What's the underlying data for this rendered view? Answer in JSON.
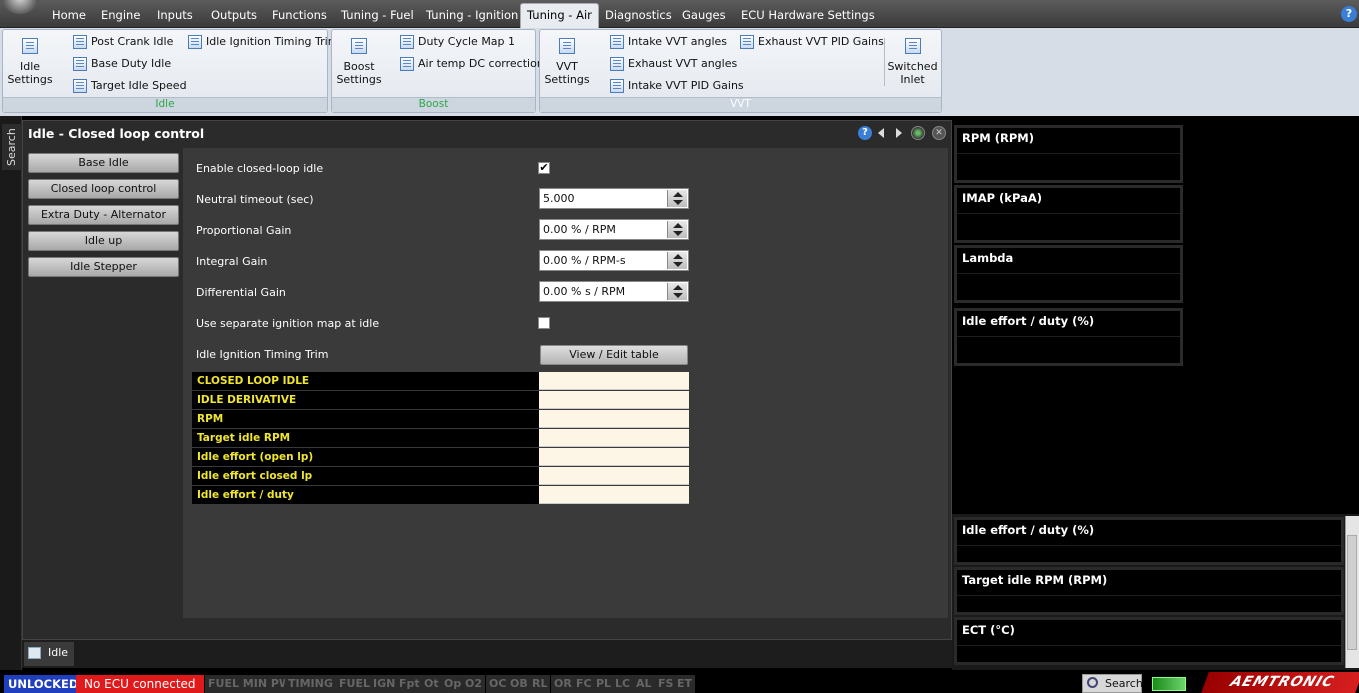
{
  "menu": {
    "items": [
      "Home",
      "Engine",
      "Inputs",
      "Outputs",
      "Functions",
      "Tuning - Fuel",
      "Tuning - Ignition",
      "Tuning - Air",
      "Diagnostics",
      "Gauges",
      "ECU Hardware Settings"
    ],
    "active": "Tuning - Air",
    "help": "?"
  },
  "ribbon": {
    "idle": {
      "group_label": "Idle",
      "big_button": "Idle\nSettings",
      "buttons": [
        "Post Crank Idle",
        "Base Duty Idle",
        "Target Idle Speed",
        "Idle Ignition Timing Trim"
      ]
    },
    "boost": {
      "group_label": "Boost",
      "big_button": "Boost\nSettings",
      "buttons": [
        "Duty Cycle Map 1",
        "Air temp DC correction"
      ]
    },
    "vvt": {
      "group_label": "VVT",
      "big_button": "VVT\nSettings",
      "buttons": [
        "Intake VVT angles",
        "Exhaust VVT angles",
        "Intake VVT PID Gains",
        "Exhaust VVT PID Gains"
      ],
      "big_button_2": "Switched\nInlet"
    }
  },
  "sidebar": {
    "search_tab": "Search"
  },
  "panel": {
    "title": "Idle - Closed loop control",
    "nav": [
      "Base Idle",
      "Closed loop control",
      "Extra Duty - Alternator",
      "Idle up",
      "Idle Stepper"
    ],
    "fields": {
      "enable_label": "Enable closed-loop idle",
      "enable_checked": true,
      "neutral_label": "Neutral timeout (sec)",
      "neutral_value": "5.000",
      "prop_label": "Proportional Gain",
      "prop_value": "0.00 % / RPM",
      "int_label": "Integral Gain",
      "int_value": "0.00 % / RPM-s",
      "diff_label": "Differential Gain",
      "diff_value": "0.00 % s / RPM",
      "sep_label": "Use separate ignition map at idle",
      "sep_checked": false,
      "trim_label": "Idle Ignition Timing Trim",
      "view_button": "View / Edit table"
    },
    "table_rows": [
      "CLOSED LOOP IDLE",
      "IDLE DERIVATIVE",
      "RPM",
      "Target idle RPM",
      "Idle effort (open lp)",
      "Idle effort closed lp",
      "Idle effort / duty"
    ]
  },
  "bottom_tab": {
    "label": "Idle"
  },
  "gauges_top": [
    "RPM (RPM)",
    "IMAP  (kPaA)",
    "Lambda",
    "Idle effort / duty (%)"
  ],
  "gauges_bottom": [
    "Idle effort / duty (%)",
    "Target idle RPM (RPM)",
    "ECT (°C)"
  ],
  "status": {
    "unlocked": "UNLOCKED",
    "no_ecu": "No ECU connected",
    "indicators": [
      "FUEL MIN PW",
      "TIMING",
      "FUEL",
      "IGN",
      "Fpt",
      "Ot",
      "Op",
      "O2",
      "OC",
      "OB",
      "RL",
      "OR",
      "FC",
      "PL",
      "LC",
      "AL",
      "FS",
      "ET"
    ],
    "search": "Search",
    "brand": "AEMTRONIC"
  },
  "colors": {
    "accent_green": "#2aa84a",
    "no_ecu": "#e01a1a",
    "unlocked": "#1f3fbf",
    "table_label": "#f0e630"
  }
}
